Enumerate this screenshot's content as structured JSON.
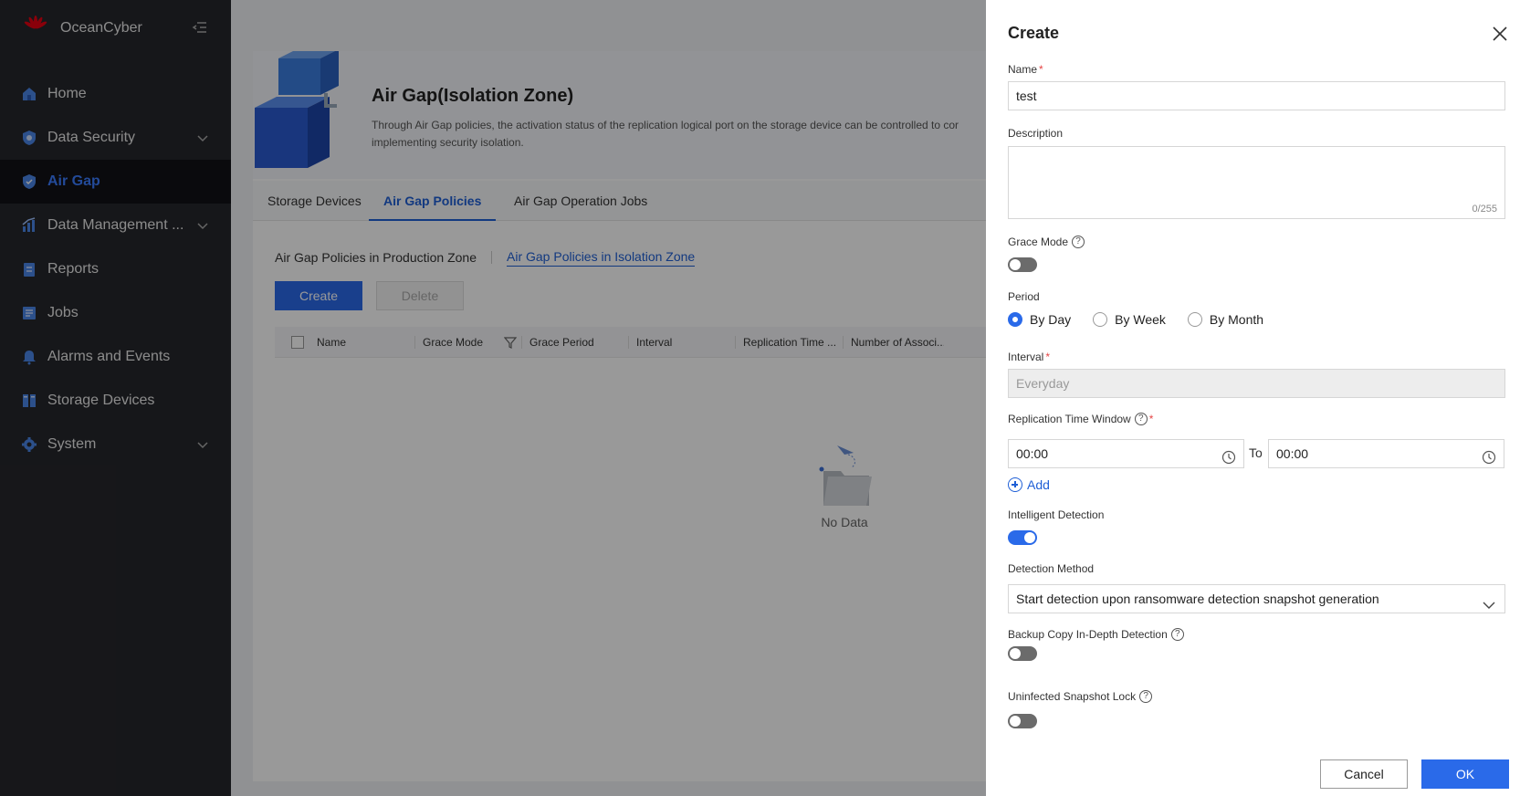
{
  "app": {
    "name": "OceanCyber",
    "vendor_logo": "huawei-logo"
  },
  "sidebar": {
    "items": [
      {
        "label": "Home",
        "icon": "home-icon",
        "expandable": false,
        "active": false
      },
      {
        "label": "Data Security",
        "icon": "shield-icon",
        "expandable": true,
        "active": false
      },
      {
        "label": "Air Gap",
        "icon": "airgap-shield-icon",
        "expandable": false,
        "active": true
      },
      {
        "label": "Data Management ...",
        "icon": "chart-icon",
        "expandable": true,
        "active": false
      },
      {
        "label": "Reports",
        "icon": "report-icon",
        "expandable": false,
        "active": false
      },
      {
        "label": "Jobs",
        "icon": "jobs-icon",
        "expandable": false,
        "active": false
      },
      {
        "label": "Alarms and Events",
        "icon": "bell-icon",
        "expandable": false,
        "active": false
      },
      {
        "label": "Storage Devices",
        "icon": "storage-icon",
        "expandable": false,
        "active": false
      },
      {
        "label": "System",
        "icon": "gear-icon",
        "expandable": true,
        "active": false
      }
    ]
  },
  "page": {
    "title": "Air Gap(Isolation Zone)",
    "description_line1": "Through Air Gap policies, the activation status of the replication logical port on the storage device can be controlled to cor",
    "description_line2": "implementing security isolation.",
    "tabs": [
      "Storage Devices",
      "Air Gap Policies",
      "Air Gap Operation Jobs"
    ],
    "active_tab": "Air Gap Policies",
    "subtabs": [
      "Air Gap Policies in Production Zone",
      "Air Gap Policies in Isolation Zone"
    ],
    "create_label": "Create",
    "delete_label": "Delete",
    "columns": [
      "Name",
      "Grace Mode",
      "Grace Period",
      "Interval",
      "Replication Time ...",
      "Number of Associ..."
    ],
    "empty_text": "No Data"
  },
  "drawer": {
    "title": "Create",
    "name_label": "Name",
    "name_value": "test",
    "description_label": "Description",
    "description_counter": "0/255",
    "grace_mode_label": "Grace Mode",
    "grace_mode_on": false,
    "period_label": "Period",
    "period_options": [
      "By Day",
      "By Week",
      "By Month"
    ],
    "period_selected": "By Day",
    "interval_label": "Interval",
    "interval_value": "Everyday",
    "replication_label": "Replication Time Window",
    "time_from": "00:00",
    "time_to_label": "To",
    "time_to": "00:00",
    "add_label": "Add",
    "intelligent_label": "Intelligent Detection",
    "intelligent_on": true,
    "detection_method_label": "Detection Method",
    "detection_method_value": "Start detection upon ransomware detection snapshot generation",
    "backup_label": "Backup Copy In-Depth Detection",
    "backup_on": false,
    "snapshot_lock_label": "Uninfected Snapshot Lock",
    "snapshot_lock_on": false,
    "cancel_label": "Cancel",
    "ok_label": "OK"
  },
  "colors": {
    "accent": "#2a6ae9",
    "sidebar_bg": "#26272c",
    "required": "#e54545"
  }
}
